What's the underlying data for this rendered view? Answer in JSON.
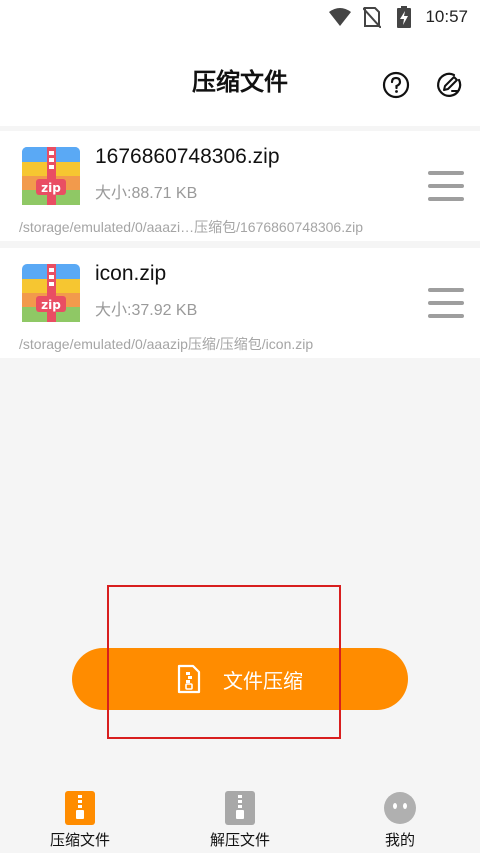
{
  "status_bar": {
    "time": "10:57"
  },
  "header": {
    "title": "压缩文件"
  },
  "files": [
    {
      "name": "1676860748306.zip",
      "size": "大小:88.71 KB",
      "path": "/storage/emulated/0/aaazi…压缩包/1676860748306.zip",
      "icon_text": "zip"
    },
    {
      "name": "icon.zip",
      "size": "大小:37.92 KB",
      "path": "/storage/emulated/0/aaazip压缩/压缩包/icon.zip",
      "icon_text": "zip"
    }
  ],
  "action": {
    "compress_label": "文件压缩"
  },
  "bottom_nav": [
    {
      "label": "压缩文件",
      "active": true
    },
    {
      "label": "解压文件",
      "active": false
    },
    {
      "label": "我的",
      "active": false
    }
  ],
  "colors": {
    "accent": "#ff8c00",
    "highlight": "#d81e1e",
    "muted": "#9e9e9e"
  }
}
